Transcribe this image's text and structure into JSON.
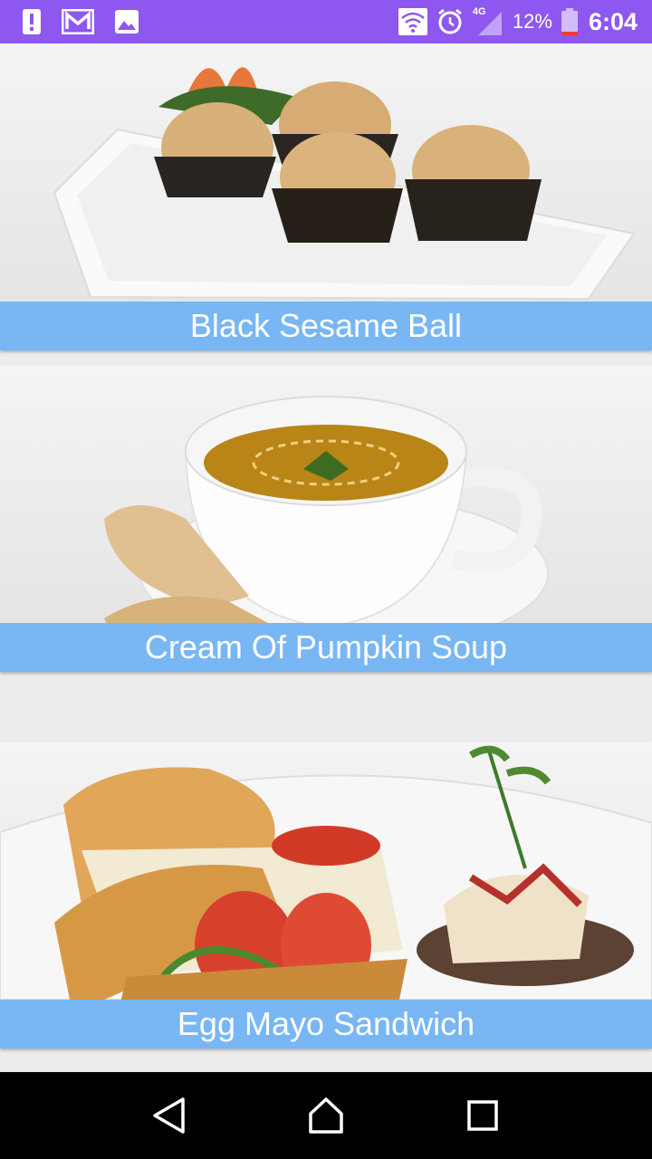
{
  "status_bar": {
    "background": "#8e57f0",
    "notification_icons": [
      "alert-icon",
      "gmail-icon",
      "image-icon"
    ],
    "system_icons": [
      "wifi-icon",
      "alarm-icon",
      "signal-4g-icon",
      "battery-icon"
    ],
    "network_label": "4G",
    "battery_percent": "12%",
    "time": "6:04"
  },
  "feed": {
    "caption_color": "#78b6f4",
    "items": [
      {
        "title": "Black Sesame Ball"
      },
      {
        "title": "Cream Of Pumpkin Soup"
      },
      {
        "title": "Egg Mayo Sandwich"
      }
    ]
  },
  "nav_bar": {
    "buttons": [
      "back-icon",
      "home-icon",
      "recents-icon"
    ]
  }
}
